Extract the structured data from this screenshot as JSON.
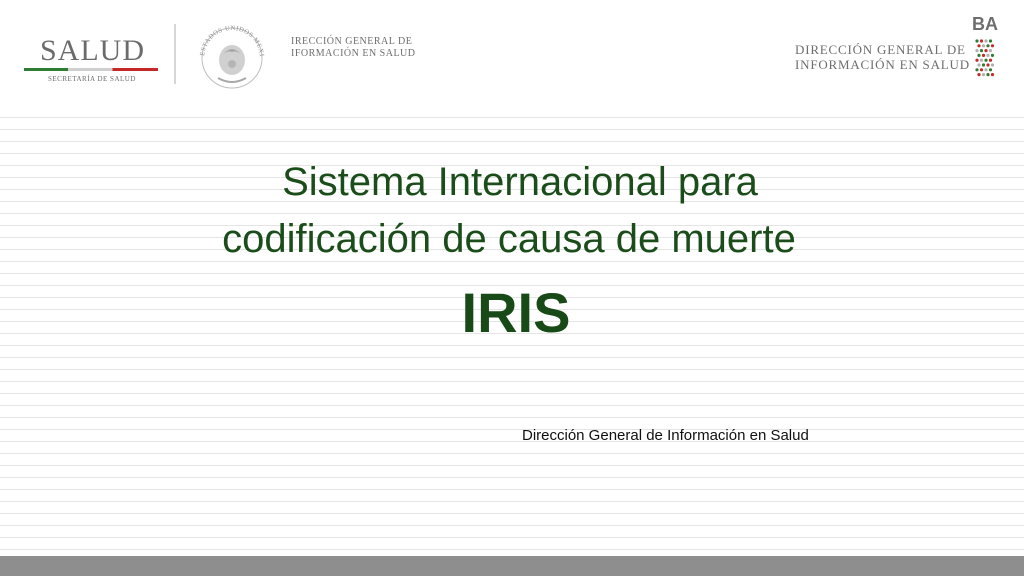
{
  "header": {
    "salud_logo": {
      "word": "SALUD",
      "subtitle": "SECRETARÍA DE SALUD"
    },
    "seal": {
      "caption": "ESTADOS UNIDOS MEXICANOS"
    },
    "dgis_small": {
      "line1": "IRECCIÓN GENERAL DE",
      "line2": "IFORMACIÓN EN SALUD"
    },
    "dgis_right": {
      "line1": "DIRECCIÓN GENERAL DE",
      "line2": "INFORMACIÓN EN SALUD"
    },
    "corner_text": "BA"
  },
  "slide": {
    "title_line1": "Sistema Internacional para",
    "title_line2": "codificación de causa de muerte",
    "acronym": "IRIS",
    "subtitle": "Dirección General de Información en Salud"
  },
  "colors": {
    "title_green": "#1b4d1b",
    "footer_gray": "#8e8e8e",
    "logo_gray": "#6b6b6b",
    "stripe_green": "#2e7d32",
    "stripe_red": "#c62828"
  }
}
